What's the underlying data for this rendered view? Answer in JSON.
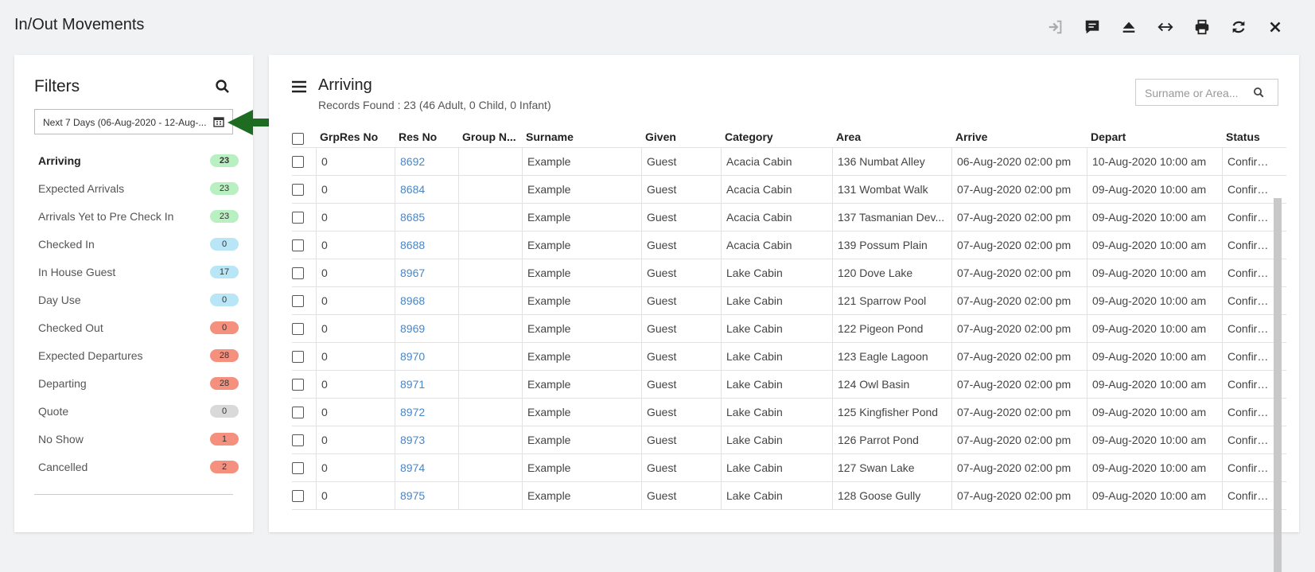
{
  "page": {
    "title": "In/Out Movements"
  },
  "toolbar": {
    "icons": [
      "sign-in-icon",
      "comment-icon",
      "eject-icon",
      "resize-horizontal-icon",
      "print-icon",
      "refresh-icon",
      "close-icon"
    ]
  },
  "filters": {
    "title": "Filters",
    "date_range": "Next 7 Days (06-Aug-2020 - 12-Aug-...",
    "items": [
      {
        "label": "Arriving",
        "count": "23",
        "color": "#b9f0c1"
      },
      {
        "label": "Expected Arrivals",
        "count": "23",
        "color": "#b9f0c1"
      },
      {
        "label": "Arrivals Yet to Pre Check In",
        "count": "23",
        "color": "#b9f0c1"
      },
      {
        "label": "Checked In",
        "count": "0",
        "color": "#b8e6f7"
      },
      {
        "label": "In House Guest",
        "count": "17",
        "color": "#b8e6f7"
      },
      {
        "label": "Day Use",
        "count": "0",
        "color": "#b8e6f7"
      },
      {
        "label": "Checked Out",
        "count": "0",
        "color": "#f5907e"
      },
      {
        "label": "Expected Departures",
        "count": "28",
        "color": "#f5907e"
      },
      {
        "label": "Departing",
        "count": "28",
        "color": "#f5907e"
      },
      {
        "label": "Quote",
        "count": "0",
        "color": "#d9d9d9"
      },
      {
        "label": "No Show",
        "count": "1",
        "color": "#f5907e"
      },
      {
        "label": "Cancelled",
        "count": "2",
        "color": "#f5907e"
      }
    ]
  },
  "main": {
    "title": "Arriving",
    "records": "Records Found : 23 (46 Adult, 0 Child, 0 Infant)",
    "search_placeholder": "Surname or Area...",
    "columns": [
      "GrpRes No",
      "Res No",
      "Group N...",
      "Surname",
      "Given",
      "Category",
      "Area",
      "Arrive",
      "Depart",
      "Status"
    ],
    "rows": [
      [
        "0",
        "8692",
        "",
        "Example",
        "Guest",
        "Acacia Cabin",
        "136 Numbat Alley",
        "06-Aug-2020 02:00 pm",
        "10-Aug-2020 10:00 am",
        "Confirmed"
      ],
      [
        "0",
        "8684",
        "",
        "Example",
        "Guest",
        "Acacia Cabin",
        "131 Wombat Walk",
        "07-Aug-2020 02:00 pm",
        "09-Aug-2020 10:00 am",
        "Confirmed"
      ],
      [
        "0",
        "8685",
        "",
        "Example",
        "Guest",
        "Acacia Cabin",
        "137 Tasmanian Dev...",
        "07-Aug-2020 02:00 pm",
        "09-Aug-2020 10:00 am",
        "Confirmed"
      ],
      [
        "0",
        "8688",
        "",
        "Example",
        "Guest",
        "Acacia Cabin",
        "139 Possum Plain",
        "07-Aug-2020 02:00 pm",
        "09-Aug-2020 10:00 am",
        "Confirmed"
      ],
      [
        "0",
        "8967",
        "",
        "Example",
        "Guest",
        "Lake Cabin",
        "120 Dove Lake",
        "07-Aug-2020 02:00 pm",
        "09-Aug-2020 10:00 am",
        "Confirmed"
      ],
      [
        "0",
        "8968",
        "",
        "Example",
        "Guest",
        "Lake Cabin",
        "121 Sparrow Pool",
        "07-Aug-2020 02:00 pm",
        "09-Aug-2020 10:00 am",
        "Confirmed"
      ],
      [
        "0",
        "8969",
        "",
        "Example",
        "Guest",
        "Lake Cabin",
        "122 Pigeon Pond",
        "07-Aug-2020 02:00 pm",
        "09-Aug-2020 10:00 am",
        "Confirmed"
      ],
      [
        "0",
        "8970",
        "",
        "Example",
        "Guest",
        "Lake Cabin",
        "123 Eagle Lagoon",
        "07-Aug-2020 02:00 pm",
        "09-Aug-2020 10:00 am",
        "Confirmed"
      ],
      [
        "0",
        "8971",
        "",
        "Example",
        "Guest",
        "Lake Cabin",
        "124 Owl Basin",
        "07-Aug-2020 02:00 pm",
        "09-Aug-2020 10:00 am",
        "Confirmed"
      ],
      [
        "0",
        "8972",
        "",
        "Example",
        "Guest",
        "Lake Cabin",
        "125 Kingfisher Pond",
        "07-Aug-2020 02:00 pm",
        "09-Aug-2020 10:00 am",
        "Confirmed"
      ],
      [
        "0",
        "8973",
        "",
        "Example",
        "Guest",
        "Lake Cabin",
        "126 Parrot Pond",
        "07-Aug-2020 02:00 pm",
        "09-Aug-2020 10:00 am",
        "Confirmed"
      ],
      [
        "0",
        "8974",
        "",
        "Example",
        "Guest",
        "Lake Cabin",
        "127 Swan Lake",
        "07-Aug-2020 02:00 pm",
        "09-Aug-2020 10:00 am",
        "Confirmed"
      ],
      [
        "0",
        "8975",
        "",
        "Example",
        "Guest",
        "Lake Cabin",
        "128 Goose Gully",
        "07-Aug-2020 02:00 pm",
        "09-Aug-2020 10:00 am",
        "Confirmed"
      ]
    ]
  },
  "annotation": {
    "arrow_color": "#1e6b22"
  }
}
